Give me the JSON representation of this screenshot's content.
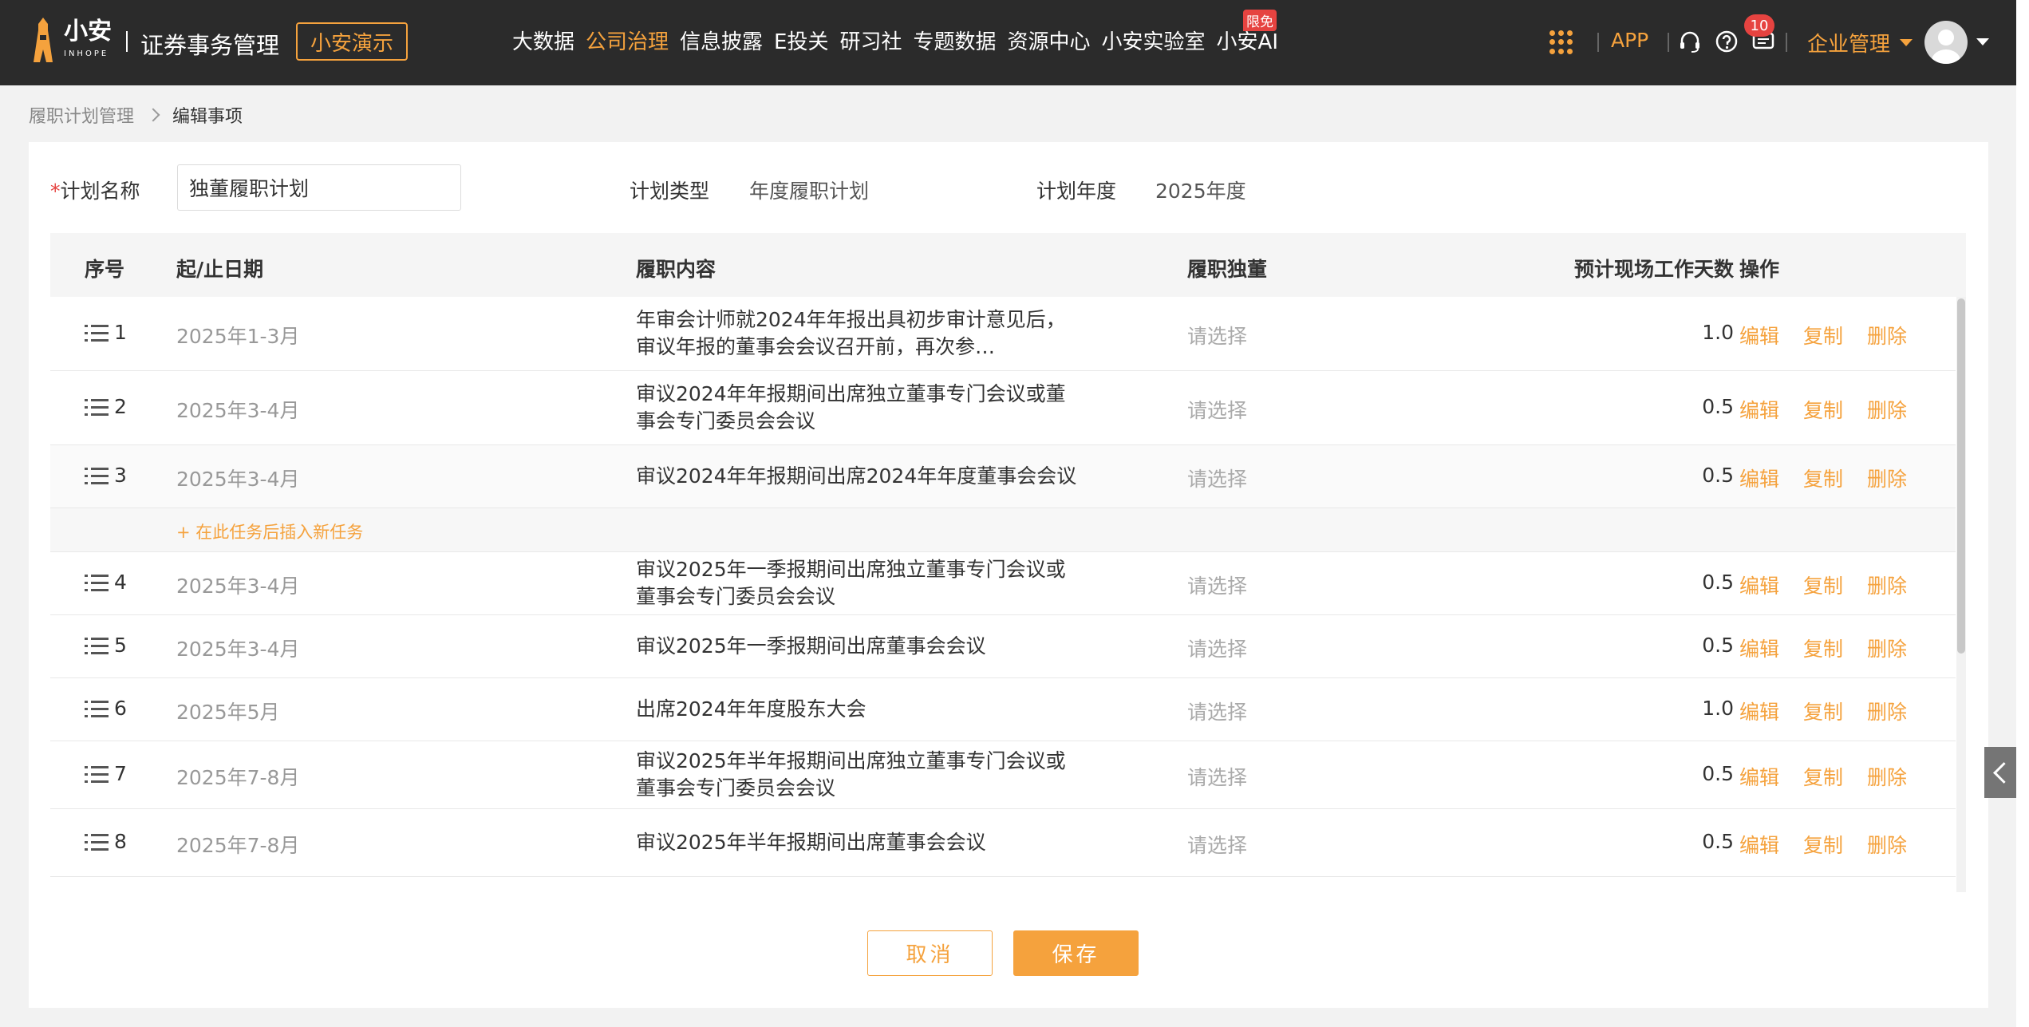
{
  "header": {
    "logo_text": "小安",
    "logo_sub": "INHOPE",
    "app_title": "证券事务管理",
    "demo_label": "小安演示",
    "nav": [
      {
        "label": "大数据",
        "active": false
      },
      {
        "label": "公司治理",
        "active": true
      },
      {
        "label": "信息披露",
        "active": false
      },
      {
        "label": "E投关",
        "active": false
      },
      {
        "label": "研习社",
        "active": false
      },
      {
        "label": "专题数据",
        "active": false
      },
      {
        "label": "资源中心",
        "active": false
      },
      {
        "label": "小安实验室",
        "active": false
      },
      {
        "label": "小安AI",
        "active": false
      }
    ],
    "free_badge": "限免",
    "app_label": "APP",
    "message_count": "10",
    "enterprise_menu": "企业管理",
    "accent_color": "#f5a23d",
    "icons": [
      "apps-grid-icon",
      "headset-icon",
      "help-icon",
      "message-icon",
      "avatar-icon"
    ]
  },
  "breadcrumb": {
    "parent": "履职计划管理",
    "current": "编辑事项"
  },
  "form": {
    "name_label": "计划名称",
    "required_mark": "*",
    "name_value": "独董履职计划",
    "type_label": "计划类型",
    "type_value": "年度履职计划",
    "year_label": "计划年度",
    "year_value": "2025年度"
  },
  "table": {
    "headers": {
      "seq": "序号",
      "date": "起/止日期",
      "content": "履职内容",
      "director": "履职独董",
      "days": "预计现场工作天数",
      "ops": "操作"
    },
    "insert_label": "在此任务后插入新任务",
    "rows": [
      {
        "seq": "1",
        "date": "2025年1-3月",
        "content_lines": [
          "年审会计师就2024年年报出具初步审计意见后，",
          "审议年报的董事会会议召开前，再次参加与年审会计师的沟通会议"
        ],
        "director": "请选择",
        "days": "1.0",
        "edit": "编辑",
        "copy": "复制",
        "delete": "删除"
      },
      {
        "seq": "2",
        "date": "2025年3-4月",
        "content_lines": [
          "审议2024年年报期间出席独立董事专门会议或董",
          "事会专门委员会会议"
        ],
        "director": "请选择",
        "days": "0.5",
        "edit": "编辑",
        "copy": "复制",
        "delete": "删除"
      },
      {
        "seq": "3",
        "date": "2025年3-4月",
        "content_lines": [
          "审议2024年年报期间出席2024年年度董事会会议"
        ],
        "director": "请选择",
        "days": "0.5",
        "edit": "编辑",
        "copy": "复制",
        "delete": "删除"
      },
      {
        "seq": "4",
        "date": "2025年3-4月",
        "content_lines": [
          "审议2025年一季报期间出席独立董事专门会议或",
          "董事会专门委员会会议"
        ],
        "director": "请选择",
        "days": "0.5",
        "edit": "编辑",
        "copy": "复制",
        "delete": "删除"
      },
      {
        "seq": "5",
        "date": "2025年3-4月",
        "content_lines": [
          "审议2025年一季报期间出席董事会会议"
        ],
        "director": "请选择",
        "days": "0.5",
        "edit": "编辑",
        "copy": "复制",
        "delete": "删除"
      },
      {
        "seq": "6",
        "date": "2025年5月",
        "content_lines": [
          "出席2024年年度股东大会"
        ],
        "director": "请选择",
        "days": "1.0",
        "edit": "编辑",
        "copy": "复制",
        "delete": "删除"
      },
      {
        "seq": "7",
        "date": "2025年7-8月",
        "content_lines": [
          "审议2025年半年报期间出席独立董事专门会议或",
          "董事会专门委员会会议"
        ],
        "director": "请选择",
        "days": "0.5",
        "edit": "编辑",
        "copy": "复制",
        "delete": "删除"
      },
      {
        "seq": "8",
        "date": "2025年7-8月",
        "content_lines": [
          "审议2025年半年报期间出席董事会会议"
        ],
        "director": "请选择",
        "days": "0.5",
        "edit": "编辑",
        "copy": "复制",
        "delete": "删除"
      }
    ]
  },
  "actions": {
    "cancel": "取消",
    "save": "保存"
  }
}
